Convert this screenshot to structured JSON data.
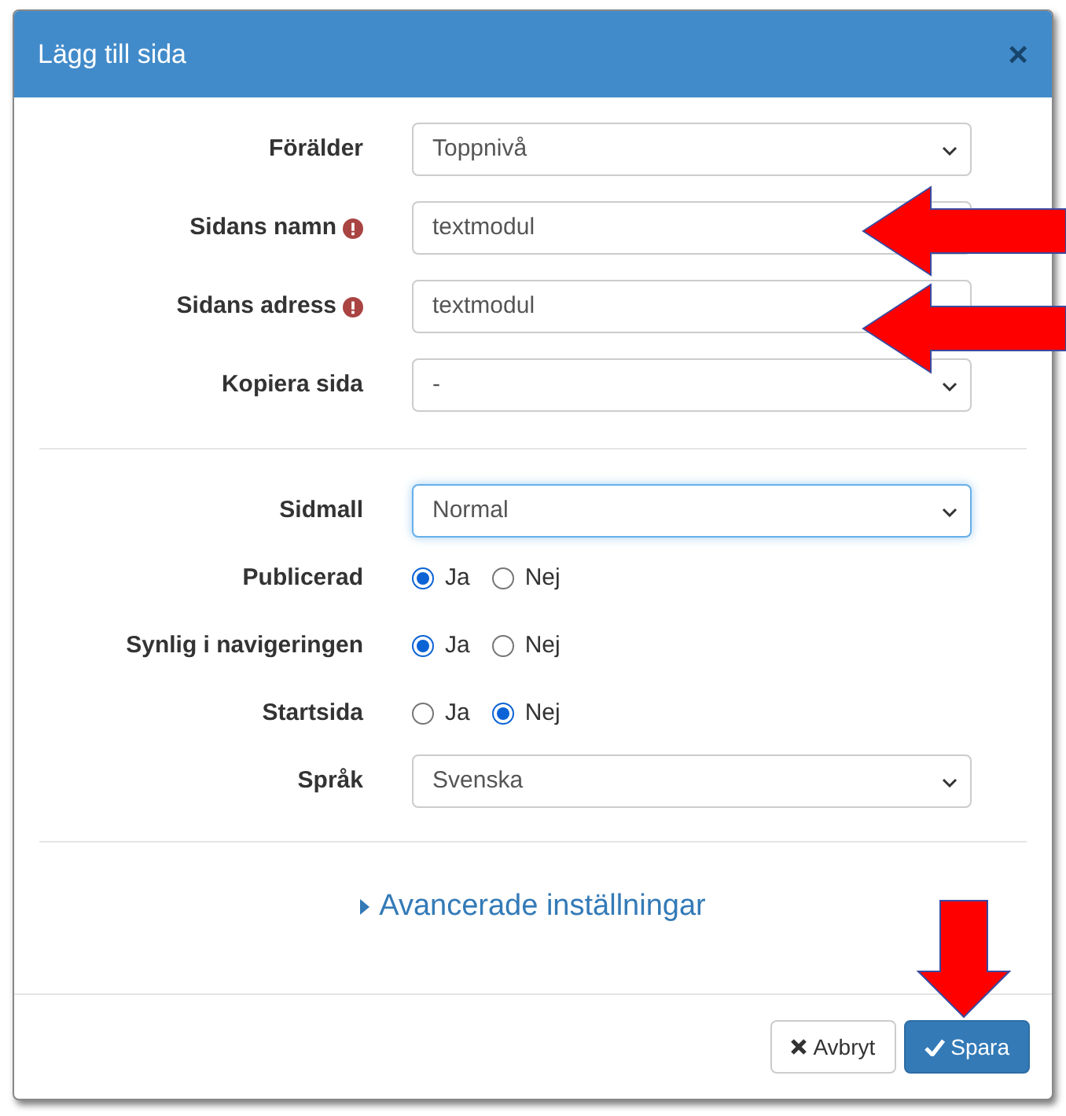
{
  "dialog": {
    "title": "Lägg till sida",
    "close": "×"
  },
  "sections": [
    {
      "fields": [
        {
          "kind": "select",
          "label": "Förälder",
          "required": false,
          "value": "Toppnivå",
          "focused": false
        },
        {
          "kind": "text",
          "label": "Sidans namn",
          "required": true,
          "value": "textmodul",
          "focused": false
        },
        {
          "kind": "text",
          "label": "Sidans adress",
          "required": true,
          "value": "textmodul",
          "focused": false
        },
        {
          "kind": "select",
          "label": "Kopiera sida",
          "required": false,
          "value": "-",
          "focused": false
        }
      ]
    },
    {
      "fields": [
        {
          "kind": "select",
          "label": "Sidmall",
          "required": false,
          "value": "Normal",
          "focused": true
        },
        {
          "kind": "radio",
          "label": "Publicerad",
          "options": [
            {
              "label": "Ja",
              "selected": true
            },
            {
              "label": "Nej",
              "selected": false
            }
          ]
        },
        {
          "kind": "radio",
          "label": "Synlig i navigeringen",
          "options": [
            {
              "label": "Ja",
              "selected": true
            },
            {
              "label": "Nej",
              "selected": false
            }
          ]
        },
        {
          "kind": "radio",
          "label": "Startsida",
          "options": [
            {
              "label": "Ja",
              "selected": false
            },
            {
              "label": "Nej",
              "selected": true
            }
          ]
        },
        {
          "kind": "select",
          "label": "Språk",
          "required": false,
          "value": "Svenska",
          "focused": false
        }
      ]
    }
  ],
  "advanced": {
    "label": "Avancerade inställningar",
    "expanded": false
  },
  "buttons": [
    {
      "kind": "cancel",
      "label": "Avbryt"
    },
    {
      "kind": "primary",
      "label": "Spara"
    }
  ]
}
